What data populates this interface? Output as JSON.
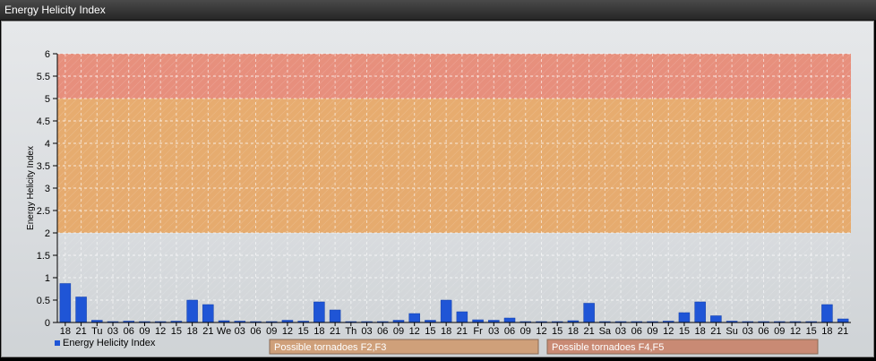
{
  "window": {
    "title": "Energy Helicity Index"
  },
  "legend": {
    "series_label": "Energy Helicity Index",
    "series_color": "#1f55d6"
  },
  "zones": [
    {
      "label": "Possible tornadoes F2,F3",
      "from": 2,
      "to": 5,
      "color": "#e8a25a"
    },
    {
      "label": "Possible tornadoes F4,F5",
      "from": 5,
      "to": 6,
      "color": "#e8806a"
    }
  ],
  "chart_data": {
    "type": "bar",
    "ylabel": "Energy Helicity Index",
    "ylim": [
      0,
      6
    ],
    "yticks": [
      "0",
      "0.5",
      "1",
      "1.5",
      "2",
      "2.5",
      "3",
      "3.5",
      "4",
      "4.5",
      "5",
      "5.5",
      "6"
    ],
    "categories": [
      "18",
      "21",
      "Tu",
      "03",
      "06",
      "09",
      "12",
      "15",
      "18",
      "21",
      "We",
      "03",
      "06",
      "09",
      "12",
      "15",
      "18",
      "21",
      "Th",
      "03",
      "06",
      "09",
      "12",
      "15",
      "18",
      "21",
      "Fr",
      "03",
      "06",
      "09",
      "12",
      "15",
      "18",
      "21",
      "Sa",
      "03",
      "06",
      "09",
      "12",
      "15",
      "18",
      "21",
      "Su",
      "03",
      "06",
      "09",
      "12",
      "15",
      "18",
      "21"
    ],
    "series": [
      {
        "name": "Energy Helicity Index",
        "values": [
          0.87,
          0.57,
          0.05,
          0.02,
          0.03,
          0.02,
          0.02,
          0.03,
          0.5,
          0.4,
          0.04,
          0.03,
          0.02,
          0.02,
          0.05,
          0.03,
          0.46,
          0.28,
          0.02,
          0.02,
          0.02,
          0.05,
          0.2,
          0.05,
          0.5,
          0.24,
          0.06,
          0.05,
          0.1,
          0.02,
          0.02,
          0.02,
          0.04,
          0.43,
          0.02,
          0.02,
          0.02,
          0.02,
          0.03,
          0.22,
          0.46,
          0.15,
          0.03,
          0.02,
          0.02,
          0.02,
          0.02,
          0.02,
          0.4,
          0.08
        ]
      }
    ],
    "grid": true,
    "legend_position": "bottom-left"
  }
}
